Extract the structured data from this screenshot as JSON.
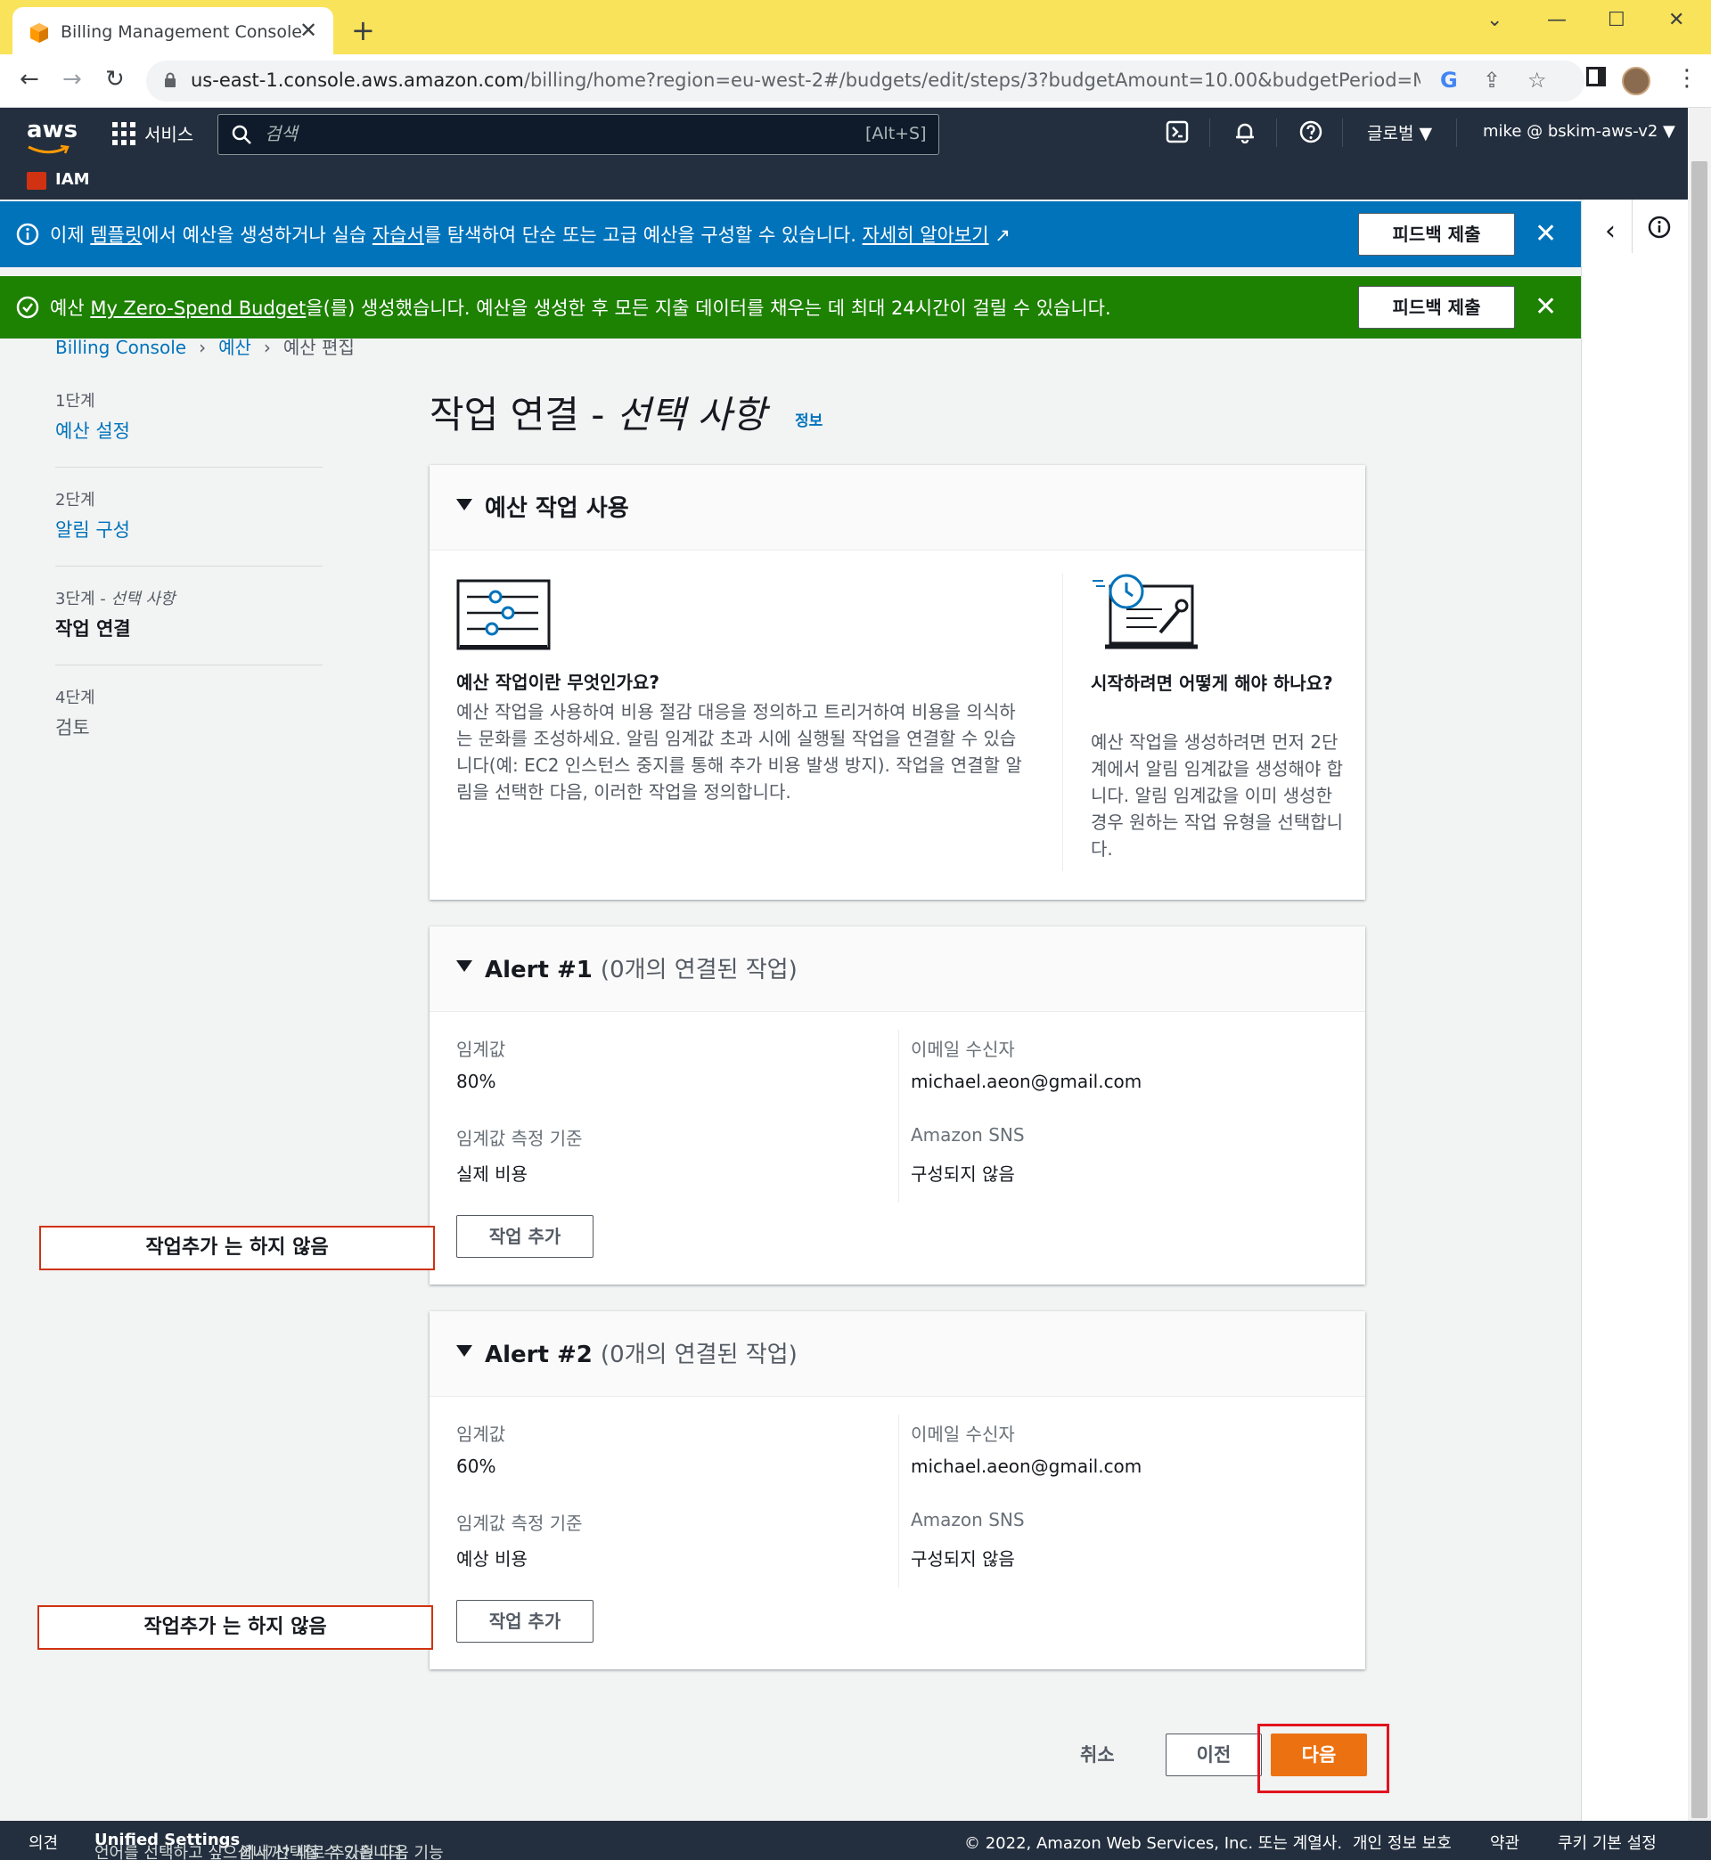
{
  "browser": {
    "tab_title": "Billing Management Console",
    "url_host": "us-east-1.console.aws.amazon.com",
    "url_path": "/billing/home?region=eu-west-2#/budgets/edit/steps/3?budgetAmount=10.00&budgetPeriod=Monthly&bu..."
  },
  "aws_nav": {
    "logo": "aws",
    "services_label": "서비스",
    "search_placeholder": "검색",
    "search_shortcut": "[Alt+S]",
    "region_label": "글로벌 ▼",
    "account_label": "mike @ bskim-aws-v2 ▼",
    "favorite_service": "IAM"
  },
  "info_flash": {
    "prefix": "이제 ",
    "templates_link": "템플릿",
    "middle": "에서 예산을 생성하거나 실습 ",
    "tutorials_link": "자습서",
    "suffix": "를 탐색하여 단순 또는 고급 예산을 구성할 수 있습니다. ",
    "learn_more_link": "자세히 알아보기",
    "button": "피드백 제출"
  },
  "success_flash": {
    "prefix": "예산 ",
    "budget_name": "My Zero-Spend Budget",
    "suffix": "을(를) 생성했습니다. 예산을 생성한 후 모든 지출 데이터를 채우는 데 최대 24시간이 걸릴 수 있습니다.",
    "button": "피드백 제출"
  },
  "breadcrumb": [
    "Billing Console",
    "예산",
    "예산 편집"
  ],
  "steps": [
    {
      "num": "1단계",
      "label": "예산 설정"
    },
    {
      "num": "2단계",
      "label": "알림 구성"
    },
    {
      "num": "3단계 - ",
      "num_optional": "선택 사항",
      "label": "작업 연결"
    },
    {
      "num": "4단계",
      "label": "검토"
    }
  ],
  "page": {
    "title": "작업 연결 - ",
    "title_optional": "선택 사항",
    "info": "정보"
  },
  "actions_panel": {
    "title": "예산 작업 사용",
    "what_title": "예산 작업이란 무엇인가요?",
    "what_body": "예산 작업을 사용하여 비용 절감 대응을 정의하고 트리거하여 비용을 의식하는 문화를 조성하세요. 알림 임계값 초과 시에 실행될 작업을 연결할 수 있습니다(예: EC2 인스턴스 중지를 통해 추가 비용 발생 방지). 작업을 연결할 알림을 선택한 다음, 이러한 작업을 정의합니다.",
    "how_title": "시작하려면 어떻게 해야 하나요?",
    "how_body": "예산 작업을 생성하려면 먼저 2단계에서 알림 임계값을 생성해야 합니다. 알림 임계값을 이미 생성한 경우 원하는 작업 유형을 선택합니다."
  },
  "alerts": [
    {
      "title": "Alert #1",
      "count": "(0개의 연결된 작업)",
      "threshold_label": "임계값",
      "threshold": "80%",
      "basis_label": "임계값 측정 기준",
      "basis": "실제 비용",
      "email_label": "이메일 수신자",
      "email": "michael.aeon@gmail.com",
      "sns_label": "Amazon SNS",
      "sns": "구성되지 않음",
      "add_button": "작업 추가",
      "annotation": "작업추가 는 하지 않음"
    },
    {
      "title": "Alert #2",
      "count": "(0개의 연결된 작업)",
      "threshold_label": "임계값",
      "threshold": "60%",
      "basis_label": "임계값 측정 기준",
      "basis": "예상 비용",
      "email_label": "이메일 수신자",
      "email": "michael.aeon@gmail.com",
      "sns_label": "Amazon SNS",
      "sns": "구성되지 않음",
      "add_button": "작업 추가",
      "annotation": "작업추가 는 하지 않음"
    }
  ],
  "wizard_buttons": {
    "cancel": "취소",
    "previous": "이전",
    "next": "다음"
  },
  "footer": {
    "feedback": "의견",
    "language_prefix": "언어를 선택하고 싶으십니까? 새로 추가된 다음 기능",
    "unified_settings": "Unified Settings",
    "language_suffix": "에서 선택할 수 있습니다.",
    "copyright": "© 2022, Amazon Web Services, Inc. 또는 계열사.",
    "privacy": "개인 정보 보호",
    "terms": "약관",
    "cookies": "쿠키 기본 설정"
  },
  "colors": {
    "browser_frame": "#f9e35a",
    "aws_nav": "#232f3e",
    "info_flash": "#0073bb",
    "success_flash": "#1d8102",
    "primary_button": "#ec7211",
    "annotation_red": "#e0141e"
  }
}
